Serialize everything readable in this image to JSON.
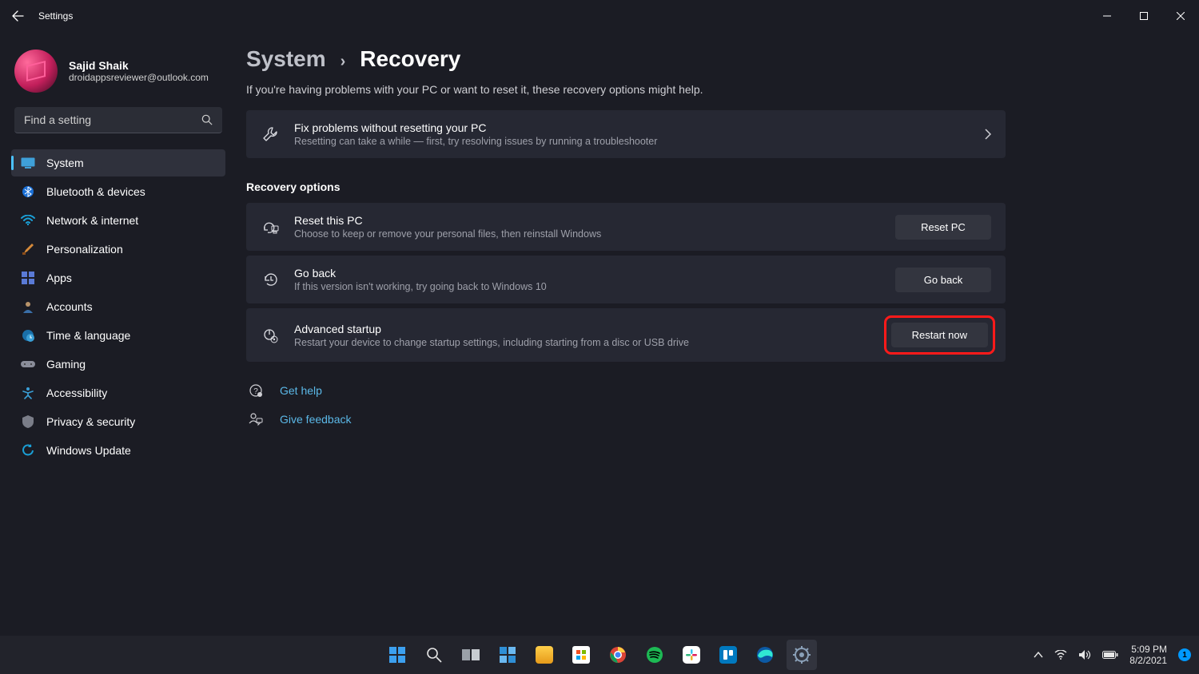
{
  "window": {
    "title": "Settings"
  },
  "user": {
    "name": "Sajid Shaik",
    "email": "droidappsreviewer@outlook.com"
  },
  "search": {
    "placeholder": "Find a setting"
  },
  "nav": {
    "items": [
      {
        "label": "System"
      },
      {
        "label": "Bluetooth & devices"
      },
      {
        "label": "Network & internet"
      },
      {
        "label": "Personalization"
      },
      {
        "label": "Apps"
      },
      {
        "label": "Accounts"
      },
      {
        "label": "Time & language"
      },
      {
        "label": "Gaming"
      },
      {
        "label": "Accessibility"
      },
      {
        "label": "Privacy & security"
      },
      {
        "label": "Windows Update"
      }
    ],
    "selected_index": 0
  },
  "breadcrumb": {
    "parent": "System",
    "current": "Recovery"
  },
  "intro": "If you're having problems with your PC or want to reset it, these recovery options might help.",
  "fix_card": {
    "title": "Fix problems without resetting your PC",
    "desc": "Resetting can take a while — first, try resolving issues by running a troubleshooter"
  },
  "recovery_section": {
    "title": "Recovery options"
  },
  "reset_card": {
    "title": "Reset this PC",
    "desc": "Choose to keep or remove your personal files, then reinstall Windows",
    "button": "Reset PC"
  },
  "goback_card": {
    "title": "Go back",
    "desc": "If this version isn't working, try going back to Windows 10",
    "button": "Go back"
  },
  "advanced_card": {
    "title": "Advanced startup",
    "desc": "Restart your device to change startup settings, including starting from a disc or USB drive",
    "button": "Restart now"
  },
  "links": {
    "get_help": "Get help",
    "give_feedback": "Give feedback"
  },
  "tray": {
    "time": "5:09 PM",
    "date": "8/2/2021",
    "badge": "1"
  }
}
